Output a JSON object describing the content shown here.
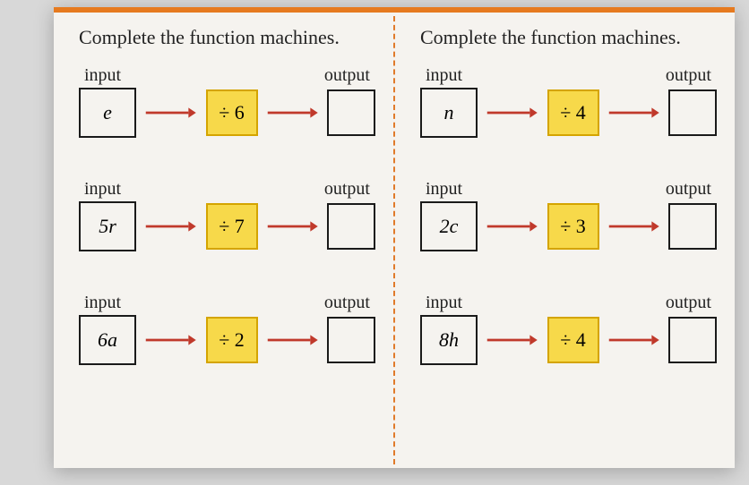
{
  "left": {
    "instruction": "Complete the function machines.",
    "machines": [
      {
        "input_label": "input",
        "output_label": "output",
        "input": "e",
        "op": "÷ 6",
        "output": ""
      },
      {
        "input_label": "input",
        "output_label": "output",
        "input": "5r",
        "op": "÷ 7",
        "output": ""
      },
      {
        "input_label": "input",
        "output_label": "output",
        "input": "6a",
        "op": "÷ 2",
        "output": ""
      }
    ]
  },
  "right": {
    "instruction": "Complete the function machines.",
    "machines": [
      {
        "input_label": "input",
        "output_label": "output",
        "input": "n",
        "op": "÷ 4",
        "output": ""
      },
      {
        "input_label": "input",
        "output_label": "output",
        "input": "2c",
        "op": "÷ 3",
        "output": ""
      },
      {
        "input_label": "input",
        "output_label": "output",
        "input": "8h",
        "op": "÷ 4",
        "output": ""
      }
    ]
  }
}
